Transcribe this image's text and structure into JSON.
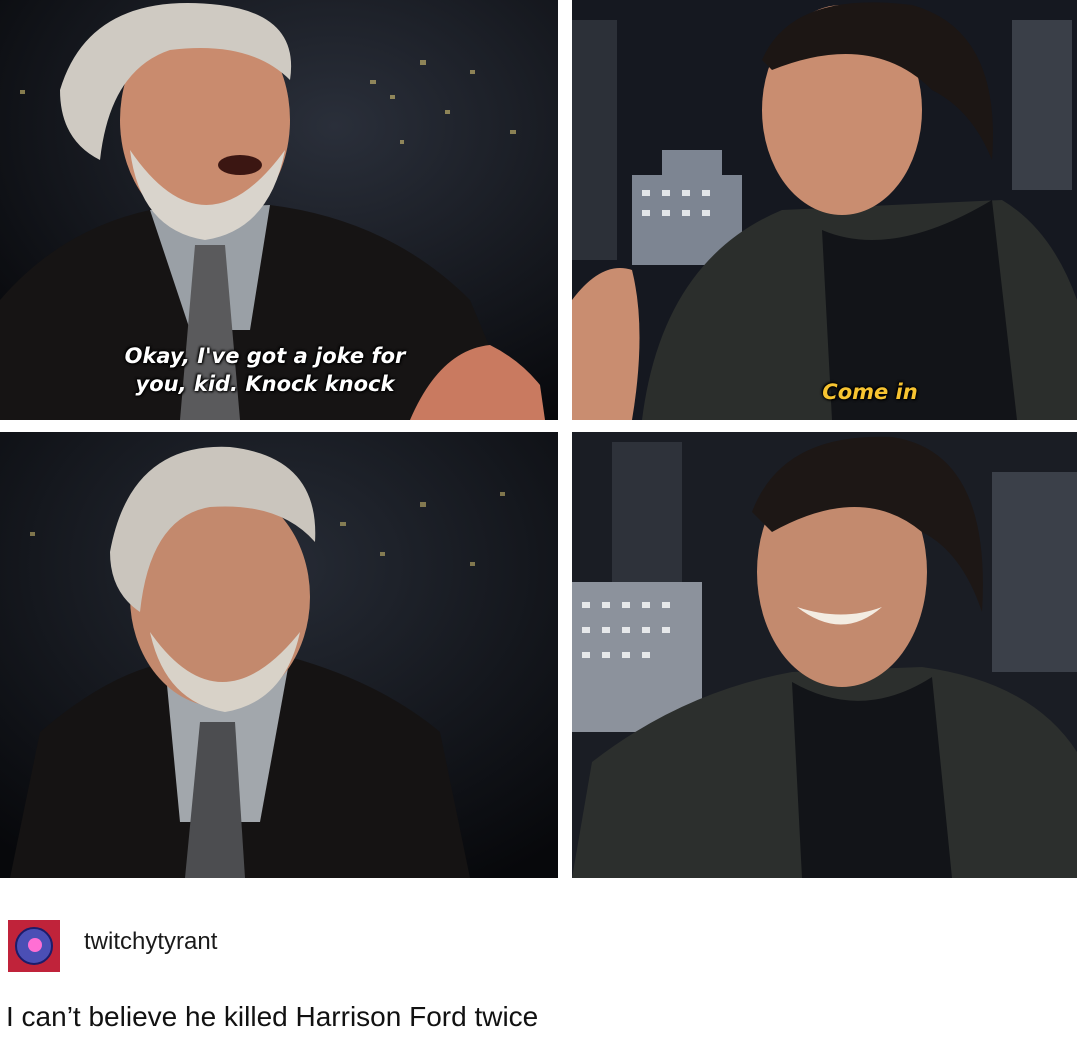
{
  "panels": {
    "panel_1": {
      "subtitle": "Okay, I've got a joke for you, kid. Knock knock"
    },
    "panel_2": {
      "subtitle": "Come in"
    }
  },
  "post": {
    "username": "twitchytyrant",
    "text": "I can’t believe he killed Harrison Ford twice"
  },
  "colors": {
    "subtitle_white": "#ffffff",
    "subtitle_yellow": "#f7c431",
    "avatar_bg": "#c0233a",
    "avatar_ring": "#4b4fb5"
  }
}
